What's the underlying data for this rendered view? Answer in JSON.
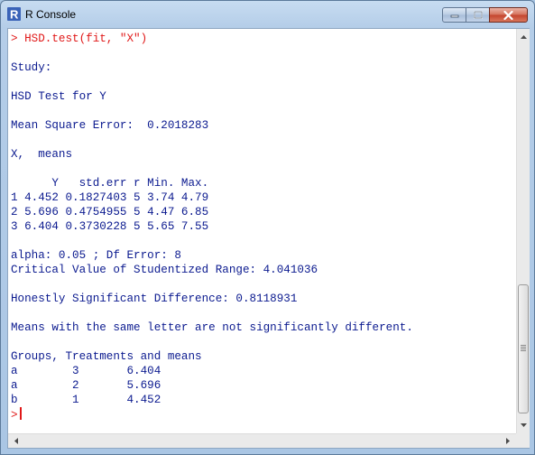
{
  "window": {
    "title": "R Console",
    "accent": "#0b1a8f",
    "command_color": "#e01818"
  },
  "console": {
    "lines": [
      {
        "text": "> HSD.test(fit, \"X\")",
        "kind": "cmd"
      },
      {
        "text": "",
        "kind": "out"
      },
      {
        "text": "Study:",
        "kind": "out"
      },
      {
        "text": "",
        "kind": "out"
      },
      {
        "text": "HSD Test for Y",
        "kind": "out"
      },
      {
        "text": "",
        "kind": "out"
      },
      {
        "text": "Mean Square Error:  0.2018283",
        "kind": "out"
      },
      {
        "text": "",
        "kind": "out"
      },
      {
        "text": "X,  means",
        "kind": "out"
      },
      {
        "text": "",
        "kind": "out"
      },
      {
        "text": "      Y   std.err r Min. Max.",
        "kind": "out"
      },
      {
        "text": "1 4.452 0.1827403 5 3.74 4.79",
        "kind": "out"
      },
      {
        "text": "2 5.696 0.4754955 5 4.47 6.85",
        "kind": "out"
      },
      {
        "text": "3 6.404 0.3730228 5 5.65 7.55",
        "kind": "out"
      },
      {
        "text": "",
        "kind": "out"
      },
      {
        "text": "alpha: 0.05 ; Df Error: 8",
        "kind": "out"
      },
      {
        "text": "Critical Value of Studentized Range: 4.041036",
        "kind": "out"
      },
      {
        "text": "",
        "kind": "out"
      },
      {
        "text": "Honestly Significant Difference: 0.8118931",
        "kind": "out"
      },
      {
        "text": "",
        "kind": "out"
      },
      {
        "text": "Means with the same letter are not significantly different.",
        "kind": "out"
      },
      {
        "text": "",
        "kind": "out"
      },
      {
        "text": "Groups, Treatments and means",
        "kind": "out"
      },
      {
        "text": "a \t 3 \t 6.404",
        "kind": "out"
      },
      {
        "text": "a \t 2 \t 5.696",
        "kind": "out"
      },
      {
        "text": "b \t 1 \t 4.452",
        "kind": "out"
      }
    ],
    "prompt": ">"
  },
  "icons": {
    "app": "r-logo-icon",
    "minimize": "minimize-icon",
    "maximize": "maximize-icon",
    "close": "close-icon"
  }
}
